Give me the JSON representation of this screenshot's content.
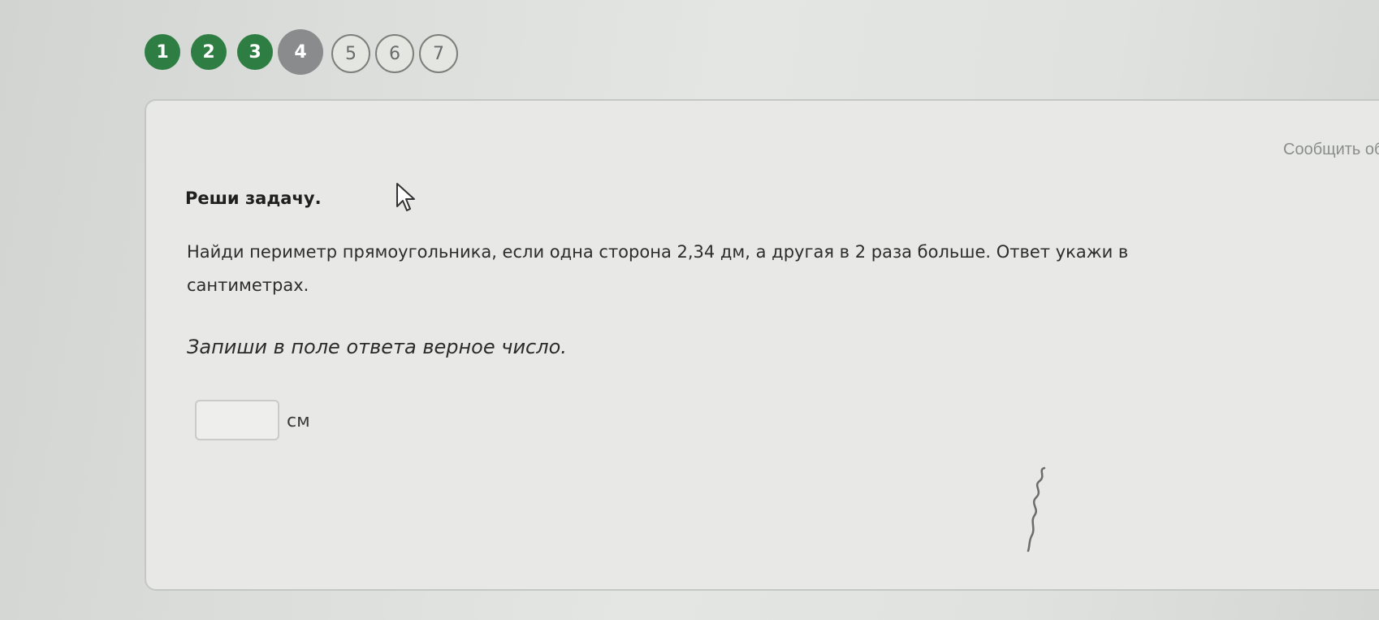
{
  "stepper": {
    "steps": [
      {
        "label": "1",
        "state": "done"
      },
      {
        "label": "2",
        "state": "done"
      },
      {
        "label": "3",
        "state": "done"
      },
      {
        "label": "4",
        "state": "current"
      },
      {
        "label": "5",
        "state": "todo"
      },
      {
        "label": "6",
        "state": "todo"
      },
      {
        "label": "7",
        "state": "todo"
      }
    ],
    "colors": {
      "done": "#2e7d43",
      "current": "#8a8b8c",
      "todo_border": "#7d7f7b"
    }
  },
  "card": {
    "report_link": "Сообщить об",
    "title": "Реши задачу.",
    "problem_line1": "Найди периметр прямоугольника, если одна сторона 2,34 дм, а другая в 2 раза больше. Ответ укажи в",
    "problem_line2": "сантиметрах.",
    "instruction": "Запиши в поле ответа верное число.",
    "answer": {
      "value": "",
      "unit": "см"
    }
  },
  "icons": {
    "cursor": "mouse-pointer-icon"
  }
}
